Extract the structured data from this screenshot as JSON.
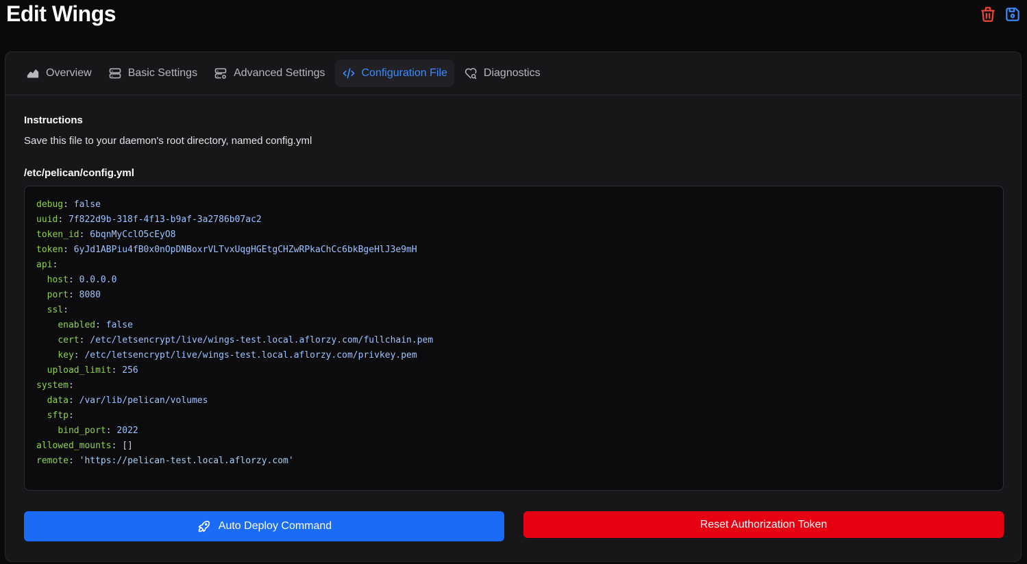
{
  "header": {
    "title": "Edit Wings"
  },
  "tabs": [
    {
      "label": "Overview",
      "icon": "chart-area-icon",
      "active": false
    },
    {
      "label": "Basic Settings",
      "icon": "server-icon",
      "active": false
    },
    {
      "label": "Advanced Settings",
      "icon": "server-cog-icon",
      "active": false
    },
    {
      "label": "Configuration File",
      "icon": "code-icon",
      "active": true
    },
    {
      "label": "Diagnostics",
      "icon": "heart-search-icon",
      "active": false
    }
  ],
  "instructions": {
    "heading": "Instructions",
    "text": "Save this file to your daemon's root directory, named config.yml"
  },
  "file": {
    "path": "/etc/pelican/config.yml",
    "lines": [
      {
        "indent": 0,
        "key": "debug",
        "value": "false"
      },
      {
        "indent": 0,
        "key": "uuid",
        "value": "7f822d9b-318f-4f13-b9af-3a2786b07ac2"
      },
      {
        "indent": 0,
        "key": "token_id",
        "value": "6bqnMyCclO5cEyO8"
      },
      {
        "indent": 0,
        "key": "token",
        "value": "6yJd1ABPiu4fB0x0nOpDNBoxrVLTvxUqgHGEtgCHZwRPkaChCc6bkBgeHlJ3e9mH"
      },
      {
        "indent": 0,
        "key": "api",
        "value": ""
      },
      {
        "indent": 1,
        "key": "host",
        "value": "0.0.0.0"
      },
      {
        "indent": 1,
        "key": "port",
        "value": "8080"
      },
      {
        "indent": 1,
        "key": "ssl",
        "value": ""
      },
      {
        "indent": 2,
        "key": "enabled",
        "value": "false"
      },
      {
        "indent": 2,
        "key": "cert",
        "value": "/etc/letsencrypt/live/wings-test.local.aflorzy.com/fullchain.pem"
      },
      {
        "indent": 2,
        "key": "key",
        "value": "/etc/letsencrypt/live/wings-test.local.aflorzy.com/privkey.pem"
      },
      {
        "indent": 1,
        "key": "upload_limit",
        "value": "256"
      },
      {
        "indent": 0,
        "key": "system",
        "value": ""
      },
      {
        "indent": 1,
        "key": "data",
        "value": "/var/lib/pelican/volumes"
      },
      {
        "indent": 1,
        "key": "sftp",
        "value": ""
      },
      {
        "indent": 2,
        "key": "bind_port",
        "value": "2022"
      },
      {
        "indent": 0,
        "key": "allowed_mounts",
        "value": "[]"
      },
      {
        "indent": 0,
        "key": "remote",
        "value": "'https://pelican-test.local.aflorzy.com'"
      }
    ]
  },
  "buttons": {
    "auto_deploy": "Auto Deploy Command",
    "reset_token": "Reset Authorization Token"
  },
  "colors": {
    "primary": "#1a6bf5",
    "danger": "#e60012",
    "active_tab": "#3d8bff",
    "yaml_key": "#8fd14f"
  }
}
